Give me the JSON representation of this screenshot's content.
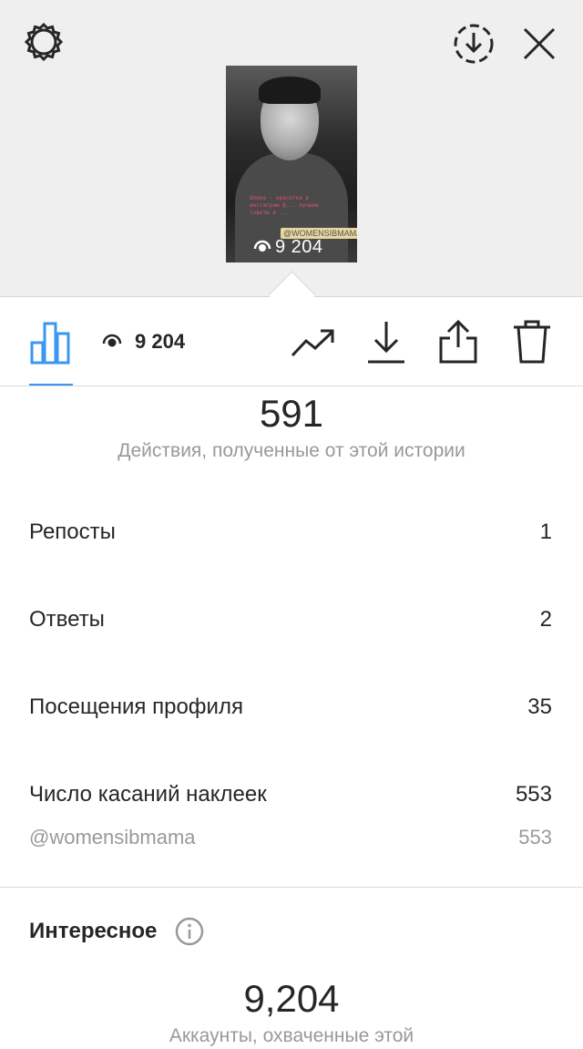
{
  "header": {
    "settings_icon": "settings-gear-icon",
    "download_circle_icon": "download-circle-icon",
    "close_icon": "close-icon"
  },
  "story_preview": {
    "caption": "Алина - красотка в инстаграм @... лучшие советы и ...",
    "tag": "@WOMENSIBMAMA",
    "views": "9 204"
  },
  "toolbar": {
    "stats_icon": "bar-chart-icon",
    "views_icon": "eye-icon",
    "views": "9 204",
    "promote_icon": "trending-up-icon",
    "save_icon": "download-icon",
    "share_icon": "share-icon",
    "delete_icon": "trash-icon"
  },
  "interactions": {
    "total": "591",
    "caption": "Действия, полученные от этой истории",
    "rows": [
      {
        "label": "Репосты",
        "value": "1"
      },
      {
        "label": "Ответы",
        "value": "2"
      },
      {
        "label": "Посещения профиля",
        "value": "35"
      },
      {
        "label": "Число касаний наклеек",
        "value": "553"
      }
    ],
    "sub_rows": [
      {
        "label": "@womensibmama",
        "value": "553"
      }
    ]
  },
  "discovery": {
    "title": "Интересное",
    "info_icon": "info-icon",
    "reach": "9,204",
    "caption": "Аккаунты, охваченные этой"
  },
  "colors": {
    "accent": "#3897f0",
    "text": "#262626",
    "muted": "#999999",
    "header_bg": "#efefef"
  }
}
